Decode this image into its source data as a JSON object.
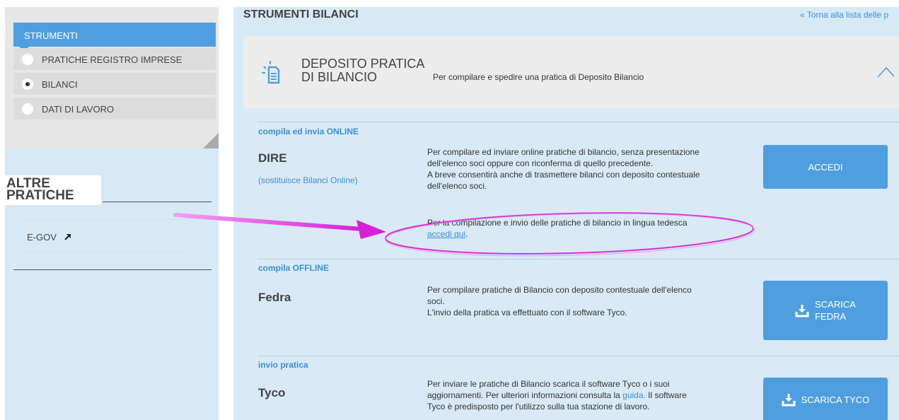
{
  "sidebar": {
    "header": "STRUMENTI",
    "items": [
      {
        "label": "PRATICHE REGISTRO IMPRESE",
        "selected": false
      },
      {
        "label": "BILANCI",
        "selected": true
      },
      {
        "label": "DATI DI LAVORO",
        "selected": false
      }
    ],
    "altre_pratiche": "ALTRE PRATICHE",
    "egov_label": "E-GOV",
    "egov_icon": "external-arrow-icon"
  },
  "main": {
    "title": "STRUMENTI BILANCI",
    "back_link": "« Torna alla lista delle p",
    "card": {
      "title": "DEPOSITO PRATICA DI BILANCIO",
      "description": "Per compilare e spedire una pratica di Deposito Bilancio",
      "icon": "document-icon",
      "collapse_icon": "chevron-up-icon"
    },
    "sections": [
      {
        "label": "compila ed invia ONLINE",
        "name": "DIRE",
        "subtitle": "(sostituisce Bilanci Online)",
        "desc_lines": [
          "Per compilare ed inviare online pratiche di bilancio, senza presentazione",
          "dell'elenco soci oppure con riconferma di quello precedente.",
          "A breve consentirà anche di trasmettere bilanci con deposito contestuale",
          "dell'elenco soci."
        ],
        "extra_line": "Per la compilazione e invio delle pratiche di bilancio in lingua tedesca",
        "extra_link": "accedi qui",
        "extra_after": ".",
        "button": "ACCEDI"
      },
      {
        "label": "compila OFFLINE",
        "name": "Fedra",
        "desc_lines": [
          "Per compilare pratiche di Bilancio con deposito contestuale dell'elenco",
          "soci.",
          "L'invio della pratica va effettuato con il software Tyco."
        ],
        "button_line1": "SCARICA",
        "button_line2": "FEDRA"
      },
      {
        "label": "invio pratica",
        "name": "Tyco",
        "desc_line1": "Per inviare le pratiche di Bilancio scarica il software Tyco o i suoi",
        "desc_line2_pre": "aggiornamenti. Per ulteriori informazioni consulta la ",
        "desc_line2_link": "guida.",
        "desc_line2_post": " Il software",
        "desc_line3": "Tyco è predisposto per l'utilizzo sulla tua stazione di lavoro.",
        "button": "SCARICA TYCO"
      }
    ]
  },
  "colors": {
    "accent": "#4f9fe0",
    "panel_bg": "#d6e9f5",
    "link": "#3b8fd8",
    "annotation": "#e040e0"
  }
}
